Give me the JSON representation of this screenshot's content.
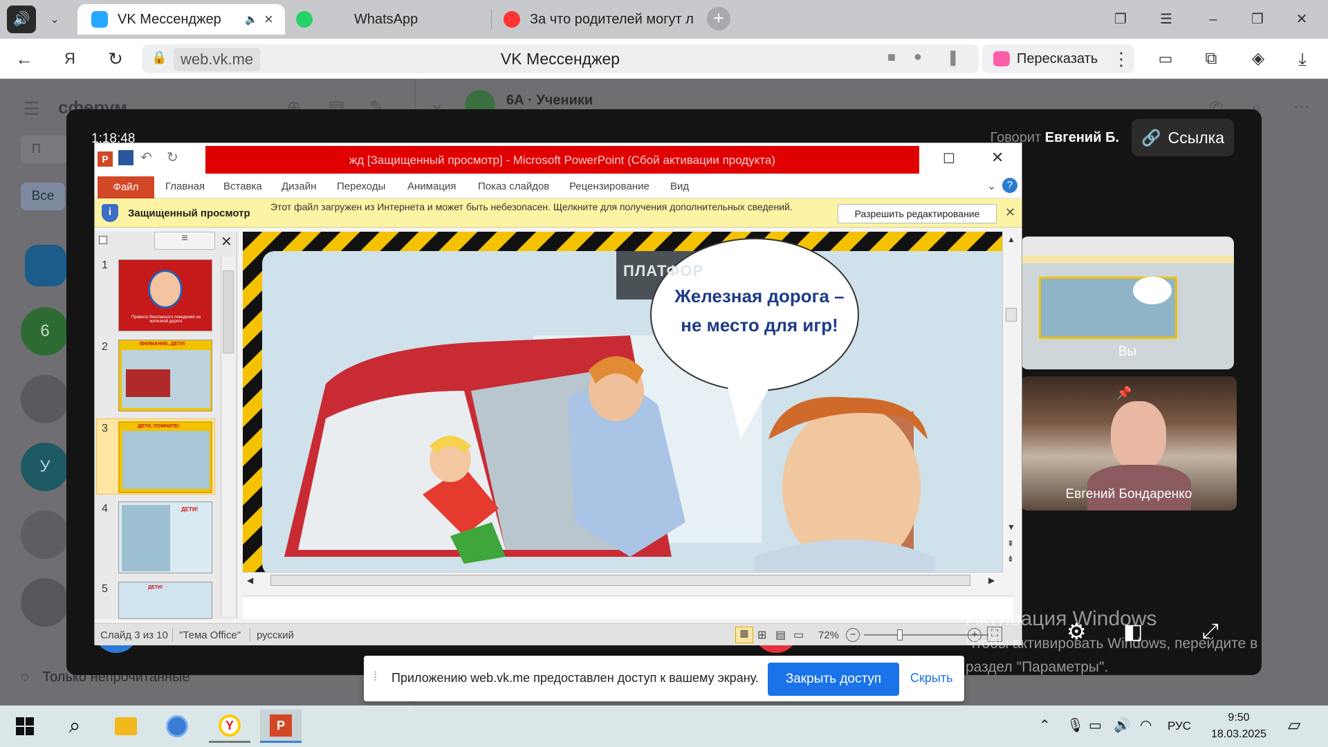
{
  "browser": {
    "tabs": [
      {
        "label": "VK Мессенджер",
        "active": true
      },
      {
        "label": "WhatsApp",
        "active": false
      },
      {
        "label": "За что родителей могут л",
        "active": false
      }
    ],
    "url": "web.vk.me",
    "page_title": "VK Мессенджер",
    "retell_label": "Пересказать"
  },
  "vk": {
    "brand": "сферум",
    "chat_title": "6А · Ученики",
    "search_placeholder": "П",
    "filter_all": "Все",
    "unread_only": "Только непрочитанные",
    "avatar_letters": [
      "6",
      "У"
    ]
  },
  "call": {
    "timer": "1:18:48",
    "speaking_prefix": "Говорит",
    "speaking_name": "Евгений Б.",
    "link_button": "Ссылка",
    "tiles": [
      {
        "label": "Вы"
      },
      {
        "label": "Евгений Бондаренко"
      }
    ]
  },
  "ppt": {
    "title": "жд [Защищенный просмотр] - Microsoft PowerPoint (Сбой активации продукта)",
    "file_tab": "Файл",
    "ribbon_tabs": [
      "Главная",
      "Вставка",
      "Дизайн",
      "Переходы",
      "Анимация",
      "Показ слайдов",
      "Рецензирование",
      "Вид"
    ],
    "protected_title": "Защищенный просмотр",
    "protected_msg": "Этот файл загружен из Интернета и может быть небезопасен. Щелкните для получения дополнительных сведений.",
    "enable_editing": "Разрешить редактирование",
    "slide_numbers": [
      "1",
      "2",
      "3",
      "4",
      "5"
    ],
    "thumb_texts": {
      "t1": "Правила безопасного поведения на железной дороге",
      "t2": "ВНИМАНИЕ, ДЕТИ!",
      "t3": "ДЕТИ, ПОМНИТЕ!",
      "t4": "ДЕТИ!",
      "t5": "ДЕТИ!"
    },
    "slide": {
      "platform_sign": "ПЛАТФОР",
      "bubble_line1": "Железная дорога –",
      "bubble_line2": "не место для игр!"
    },
    "status": {
      "slide_of": "Слайд 3 из 10",
      "theme": "\"Тема Office\"",
      "language": "русский",
      "zoom": "72%"
    }
  },
  "share_notice": {
    "message": "Приложению web.vk.me предоставлен доступ к вашему экрану.",
    "stop_button": "Закрыть доступ",
    "hide_button": "Скрыть"
  },
  "windows_activation": {
    "heading": "Активация Windows",
    "line1": "Чтобы активировать Windows, перейдите в",
    "line2": "раздел \"Параметры\"."
  },
  "taskbar": {
    "language": "РУС",
    "time": "9:50",
    "date": "18.03.2025"
  },
  "colors": {
    "vk_blue": "#0077ff",
    "ppt_red": "#e00000",
    "file_tab": "#d24726",
    "share_blue": "#1a73e8",
    "protected_yellow": "#fdf3a4"
  }
}
